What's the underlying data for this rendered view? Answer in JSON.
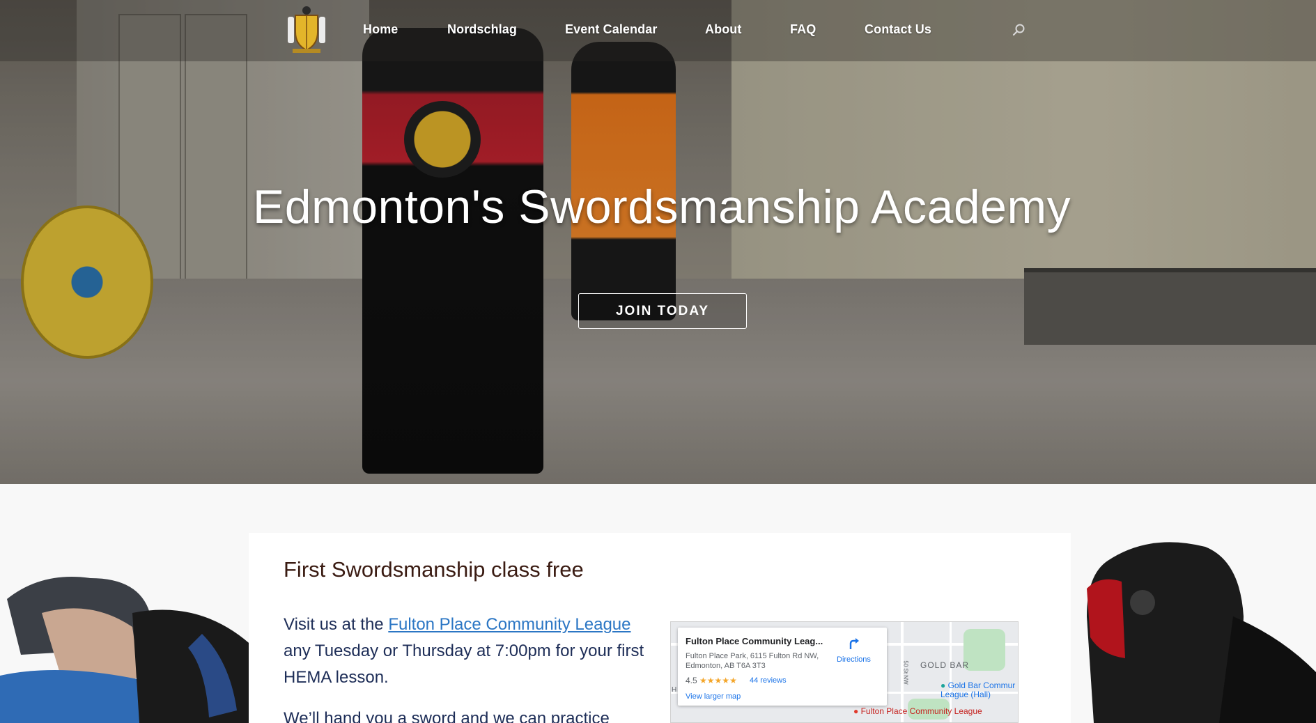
{
  "nav": {
    "items": [
      "Home",
      "Nordschlag",
      "Event Calendar",
      "About",
      "FAQ",
      "Contact Us"
    ]
  },
  "hero": {
    "title": "Edmonton's Swordsmanship Academy",
    "button": "JOIN TODAY"
  },
  "section": {
    "title": "First Swordsmanship class free",
    "text_before": "Visit us at the ",
    "link": "Fulton Place Community League",
    "text_after": " any Tuesday or Thursday at 7:00pm for your first HEMA lesson.",
    "text2": "We’ll hand you a sword and we can practice"
  },
  "map": {
    "name": "Fulton Place Community Leag...",
    "address": "Fulton Place Park, 6115 Fulton Rd NW, Edmonton, AB T6A 3T3",
    "rating": "4.5",
    "stars": "★★★★★",
    "reviews": "44 reviews",
    "larger": "View larger map",
    "directions": "Directions",
    "label_goldbar": "GOLD BAR",
    "label_league": "Gold Bar Commur League (Hall)",
    "label_fulton": "Fulton Place Community League",
    "road": "50 St NW",
    "edge_letter": "H"
  },
  "colors": {
    "title": "#3a1b12",
    "body": "#1d2d57",
    "link": "#2b76c4"
  }
}
